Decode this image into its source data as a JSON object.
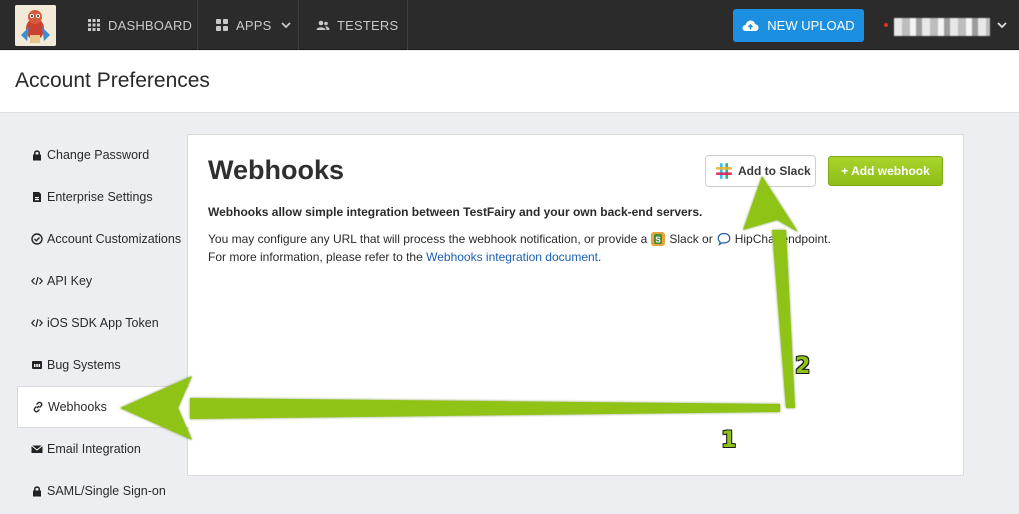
{
  "topbar": {
    "nav": [
      {
        "label": "DASHBOARD",
        "icon": "grid-icon"
      },
      {
        "label": "APPS",
        "icon": "apps-icon"
      },
      {
        "label": "TESTERS",
        "icon": "people-icon"
      }
    ],
    "upload_label": "NEW UPLOAD",
    "upload_color": "#1d8fe1"
  },
  "page_title": "Account Preferences",
  "sidebar": {
    "items": [
      {
        "label": "Change Password",
        "icon": "lock-icon"
      },
      {
        "label": "Enterprise Settings",
        "icon": "building-icon"
      },
      {
        "label": "Account Customizations",
        "icon": "check-circle-icon"
      },
      {
        "label": "API Key",
        "icon": "code-icon"
      },
      {
        "label": "iOS SDK App Token",
        "icon": "code-icon"
      },
      {
        "label": "Bug Systems",
        "icon": "bug-icon"
      },
      {
        "label": "Webhooks",
        "icon": "link-icon",
        "active": true
      },
      {
        "label": "Email Integration",
        "icon": "envelope-icon"
      },
      {
        "label": "SAML/Single Sign-on",
        "icon": "lock-icon"
      }
    ]
  },
  "panel": {
    "title": "Webhooks",
    "slack_button": "Add to Slack",
    "add_webhook_button": "+ Add webhook",
    "lead": "Webhooks allow simple integration between TestFairy and your own back-end servers.",
    "line1": {
      "prefix": "You may configure any URL that will process the webhook notification, or provide a",
      "slack": "Slack or",
      "hipchat": "HipChat endpoint."
    },
    "line2": {
      "prefix": "For more information, please refer to the",
      "link": "Webhooks integration document",
      "suffix": "."
    }
  },
  "annotations": {
    "label_1": "1",
    "label_2": "2",
    "arrow_color": "#8fc319"
  }
}
